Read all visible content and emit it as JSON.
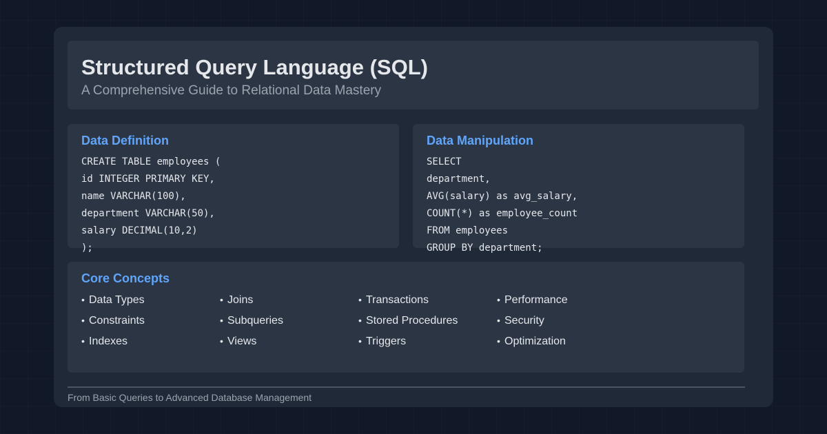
{
  "header": {
    "title": "Structured Query Language (SQL)",
    "subtitle": "A Comprehensive Guide to Relational Data Mastery"
  },
  "data_definition": {
    "title": "Data Definition",
    "code_lines": [
      "CREATE TABLE employees (",
      "id INTEGER PRIMARY KEY,",
      "name VARCHAR(100),",
      "department VARCHAR(50),",
      "salary DECIMAL(10,2)",
      ");"
    ]
  },
  "data_manipulation": {
    "title": "Data Manipulation",
    "code_lines": [
      "SELECT",
      "department,",
      "AVG(salary) as avg_salary,",
      "COUNT(*) as employee_count",
      "FROM employees",
      "GROUP BY department;"
    ]
  },
  "core_concepts": {
    "title": "Core Concepts",
    "bullet": "•",
    "items": [
      "Data Types",
      "Constraints",
      "Indexes",
      "Joins",
      "Subqueries",
      "Views",
      "Transactions",
      "Stored Procedures",
      "Triggers",
      "Performance",
      "Security",
      "Optimization"
    ]
  },
  "footer": {
    "text": "From Basic Queries to Advanced Database Management"
  },
  "colors": {
    "page_background": "#111827",
    "card_background": "#1f2937",
    "panel_background": "#2b3544",
    "accent": "#60a5fa",
    "text_primary": "#e5e7eb",
    "text_secondary": "#9ca3af"
  }
}
